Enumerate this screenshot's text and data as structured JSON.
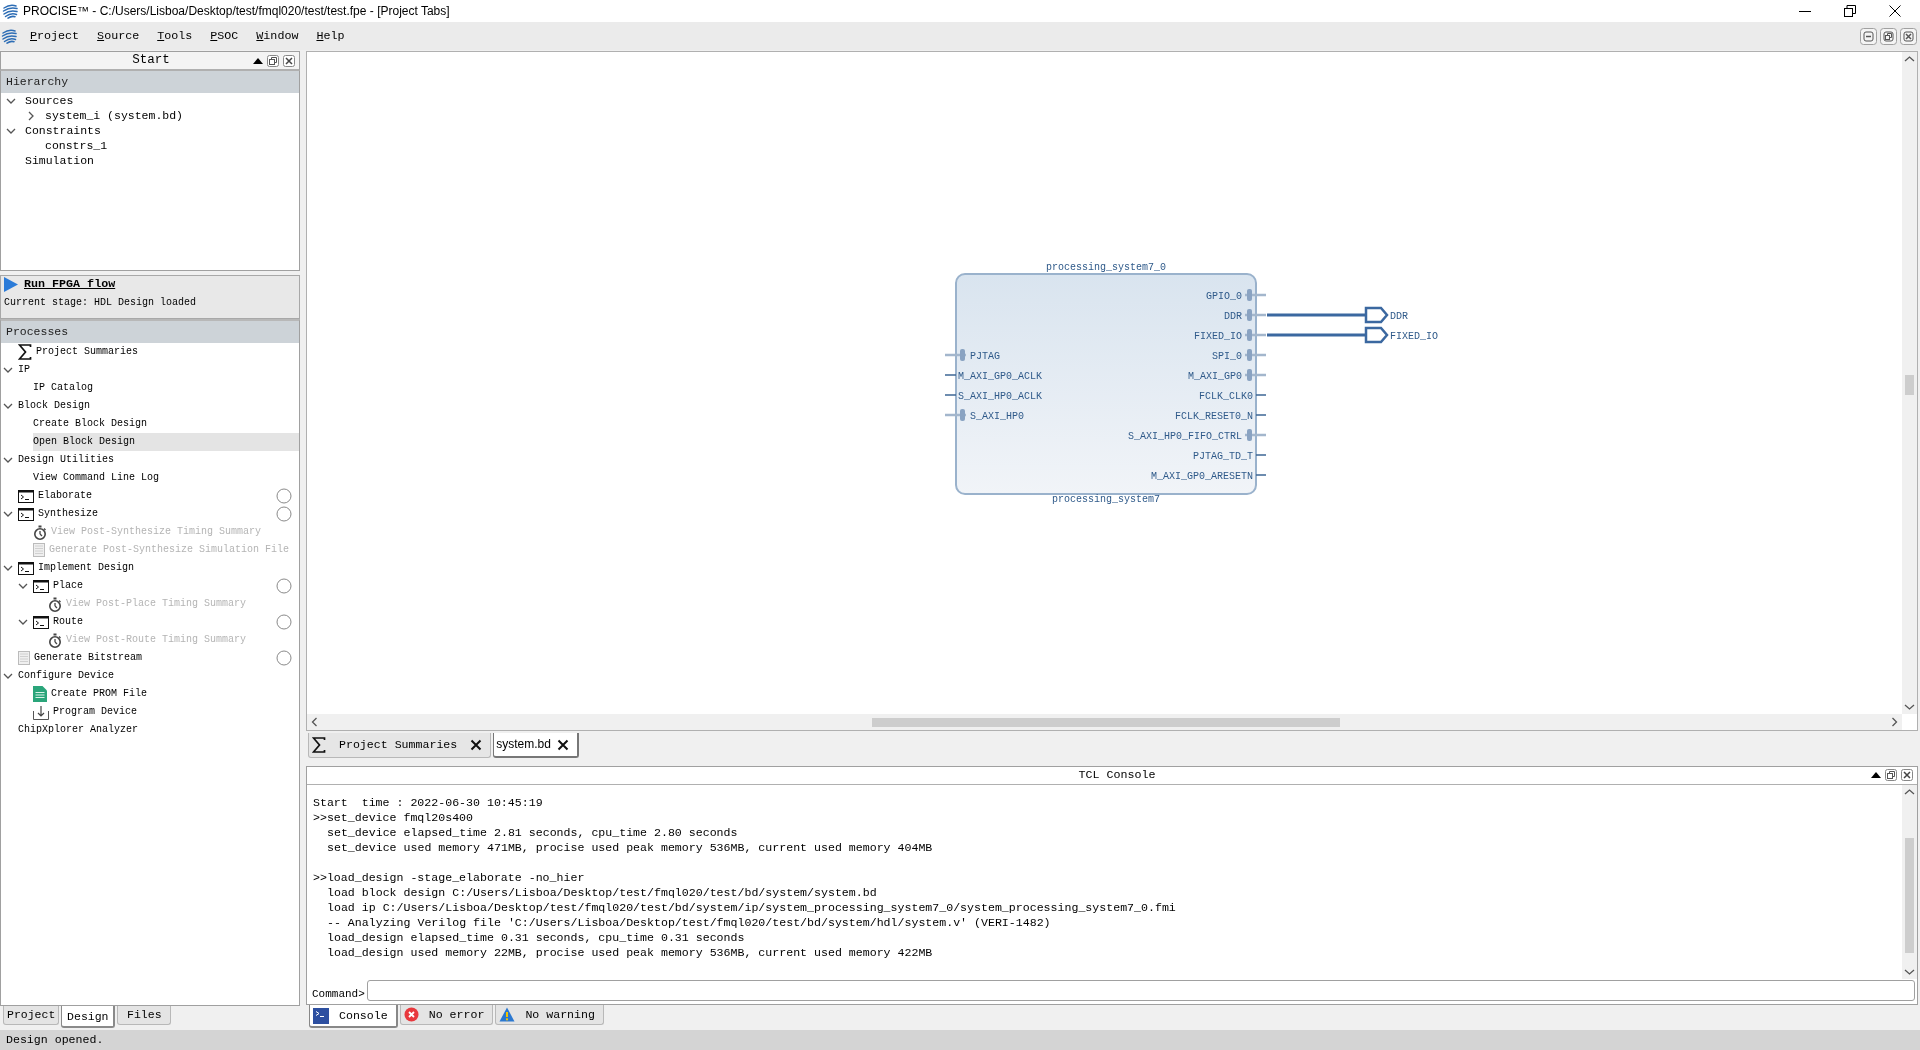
{
  "window": {
    "title": "PROCISE™ - C:/Users/Lisboa/Desktop/test/fmql020/test/test.fpe - [Project Tabs]"
  },
  "menu": [
    "Project",
    "Source",
    "Tools",
    "PSOC",
    "Window",
    "Help"
  ],
  "start_panel": {
    "title": "Start",
    "hierarchy_title": "Hierarchy",
    "hierarchy": [
      {
        "label": "Sources",
        "expanded": true,
        "children": [
          {
            "label": "system_i (system.bd)",
            "expanded": false
          }
        ]
      },
      {
        "label": "Constraints",
        "expanded": true,
        "children": [
          {
            "label": "constrs_1"
          }
        ]
      },
      {
        "label": "Simulation"
      }
    ]
  },
  "flow": {
    "action": "Run FPGA flow",
    "stage": "Current stage: HDL Design loaded"
  },
  "processes": {
    "title": "Processes",
    "items": [
      {
        "label": "Project Summaries",
        "kind": "summary",
        "selected": false,
        "disabled": false
      },
      {
        "label": "IP",
        "kind": "plain",
        "selected": false,
        "disabled": false,
        "expanded": true,
        "children": [
          {
            "label": "IP Catalog",
            "kind": "plain",
            "selected": false,
            "disabled": false
          }
        ]
      },
      {
        "label": "Block Design",
        "kind": "plain",
        "selected": false,
        "disabled": false,
        "expanded": true,
        "children": [
          {
            "label": "Create Block Design",
            "kind": "plain",
            "selected": false,
            "disabled": false
          },
          {
            "label": "Open Block Design",
            "kind": "plain",
            "selected": true,
            "disabled": false
          }
        ]
      },
      {
        "label": "Design Utilities",
        "kind": "plain",
        "selected": false,
        "disabled": false,
        "expanded": true,
        "children": [
          {
            "label": "View Command Line Log",
            "kind": "plain",
            "selected": false,
            "disabled": false
          }
        ]
      },
      {
        "label": "Elaborate",
        "kind": "run",
        "selected": false,
        "disabled": false,
        "completed": false
      },
      {
        "label": "Synthesize",
        "kind": "run",
        "selected": false,
        "disabled": false,
        "completed": false,
        "expanded": true,
        "children": [
          {
            "label": "View Post-Synthesize Timing Summary",
            "kind": "timing",
            "selected": false,
            "disabled": true
          },
          {
            "label": "Generate Post-Synthesize Simulation File",
            "kind": "table",
            "selected": false,
            "disabled": true
          }
        ]
      },
      {
        "label": "Implement Design",
        "kind": "run",
        "selected": false,
        "disabled": false,
        "expanded": true,
        "children": [
          {
            "label": "Place",
            "kind": "run",
            "selected": false,
            "disabled": false,
            "completed": false,
            "expanded": true,
            "children": [
              {
                "label": "View Post-Place Timing Summary",
                "kind": "timing",
                "selected": false,
                "disabled": true
              }
            ]
          },
          {
            "label": "Route",
            "kind": "run",
            "selected": false,
            "disabled": false,
            "completed": false,
            "expanded": true,
            "children": [
              {
                "label": "View Post-Route Timing Summary",
                "kind": "timing",
                "selected": false,
                "disabled": true
              }
            ]
          }
        ]
      },
      {
        "label": "Generate Bitstream",
        "kind": "table",
        "selected": false,
        "disabled": false,
        "completed": false
      },
      {
        "label": "Configure Device",
        "kind": "plain",
        "selected": false,
        "disabled": false,
        "expanded": true,
        "children": [
          {
            "label": "Create PROM File",
            "kind": "prom",
            "selected": false,
            "disabled": false
          },
          {
            "label": "Program Device",
            "kind": "download",
            "selected": false,
            "disabled": false
          }
        ]
      },
      {
        "label": "ChipXplorer Analyzer",
        "kind": "plain",
        "selected": false,
        "disabled": false
      }
    ]
  },
  "left_tabs": [
    {
      "label": "Project",
      "selected": false
    },
    {
      "label": "Design",
      "selected": true
    },
    {
      "label": "Files",
      "selected": false
    }
  ],
  "diagram": {
    "block": {
      "instance": "processing_system7_0",
      "type": "processing_system7",
      "left_ports": [
        {
          "name": "PJTAG",
          "kind": "bus"
        },
        {
          "name": "M_AXI_GP0_ACLK",
          "kind": "wire"
        },
        {
          "name": "S_AXI_HP0_ACLK",
          "kind": "wire"
        },
        {
          "name": "S_AXI_HP0",
          "kind": "bus"
        }
      ],
      "right_ports": [
        {
          "name": "GPIO_0",
          "kind": "bus"
        },
        {
          "name": "DDR",
          "kind": "bus",
          "external": {
            "name": "DDR"
          }
        },
        {
          "name": "FIXED_IO",
          "kind": "bus",
          "external": {
            "name": "FIXED_IO"
          }
        },
        {
          "name": "SPI_0",
          "kind": "bus"
        },
        {
          "name": "M_AXI_GP0",
          "kind": "bus"
        },
        {
          "name": "FCLK_CLK0",
          "kind": "wire"
        },
        {
          "name": "FCLK_RESET0_N",
          "kind": "wire"
        },
        {
          "name": "S_AXI_HP0_FIFO_CTRL",
          "kind": "bus"
        },
        {
          "name": "PJTAG_TD_T",
          "kind": "wire"
        },
        {
          "name": "M_AXI_GP0_ARESETN",
          "kind": "wire"
        }
      ]
    }
  },
  "document_tabs": [
    {
      "label": "Project Summaries",
      "kind": "summary",
      "selected": false
    },
    {
      "label": "system.bd",
      "kind": "file",
      "selected": true
    }
  ],
  "console": {
    "title": "TCL Console",
    "blocks": [
      [
        {
          "kind": "info",
          "text": "Start  time : 2022-06-30 10:45:19"
        },
        {
          "kind": "command",
          "text": ">>set_device fmql20s400"
        },
        {
          "kind": "output",
          "text": "set_device elapsed_time 2.81 seconds, cpu_time 2.80 seconds"
        },
        {
          "kind": "output",
          "text": "set_device used memory 471MB, procise used peak memory 536MB, current used memory 404MB"
        }
      ],
      [
        {
          "kind": "command",
          "text": ">>load_design -stage_elaborate -no_hier"
        },
        {
          "kind": "output",
          "text": "load block design C:/Users/Lisboa/Desktop/test/fmql020/test/bd/system/system.bd"
        },
        {
          "kind": "output",
          "text": "load ip C:/Users/Lisboa/Desktop/test/fmql020/test/bd/system/ip/system_processing_system7_0/system_processing_system7_0.fmi"
        },
        {
          "kind": "output",
          "text": "-- Analyzing Verilog file 'C:/Users/Lisboa/Desktop/test/fmql020/test/bd/system/hdl/system.v' (VERI-1482)"
        },
        {
          "kind": "output",
          "text": "load_design elapsed_time 0.31 seconds, cpu_time 0.31 seconds"
        },
        {
          "kind": "output",
          "text": "load_design used memory 22MB, procise used peak memory 536MB, current used memory 422MB"
        }
      ]
    ],
    "prompt": "Command>"
  },
  "console_tabs": [
    {
      "label": "Console",
      "kind": "console",
      "selected": true
    },
    {
      "label": "No error",
      "kind": "error",
      "selected": false
    },
    {
      "label": "No warning",
      "kind": "warning",
      "selected": false
    }
  ],
  "status_bar": "Design opened."
}
